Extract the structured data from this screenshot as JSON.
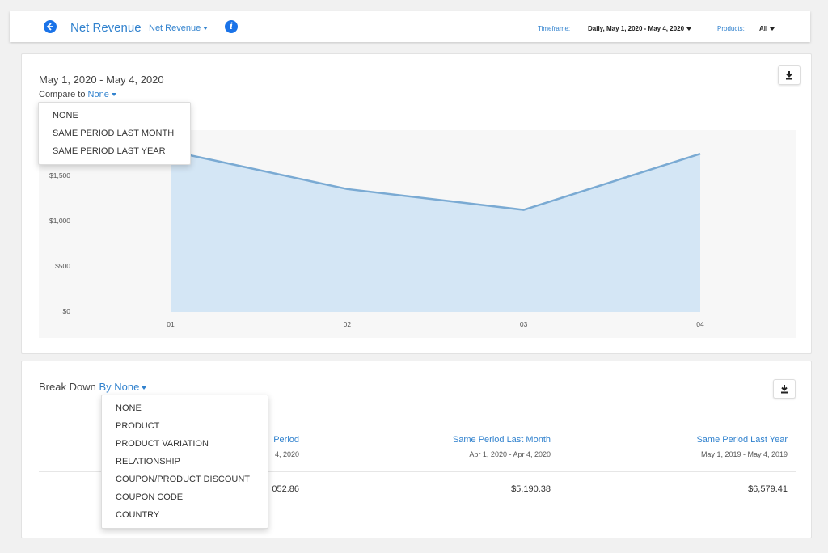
{
  "header": {
    "title": "Net Revenue",
    "metric_select": "Net Revenue",
    "info_icon": "info-icon",
    "timeframe_label": "Timeframe:",
    "timeframe_value": "Daily, May 1, 2020 - May 4, 2020",
    "products_label": "Products:",
    "products_value": "All"
  },
  "chart_card": {
    "range_title": "May 1, 2020 - May 4, 2020",
    "compare_label": "Compare to",
    "compare_value": "None",
    "compare_options": [
      "NONE",
      "SAME PERIOD LAST MONTH",
      "SAME PERIOD LAST YEAR"
    ],
    "download_icon": "download-icon"
  },
  "chart_data": {
    "type": "area",
    "categories": [
      "01",
      "02",
      "03",
      "04"
    ],
    "values": [
      1780,
      1360,
      1130,
      1750
    ],
    "ylim": [
      0,
      1850
    ],
    "yticks": [
      "$0",
      "$500",
      "$1,000",
      "$1,500"
    ],
    "ytick_values": [
      0,
      500,
      1000,
      1500
    ],
    "grid": false,
    "fill_color": "#d4e6f5",
    "line_color": "#7aaad3"
  },
  "breakdown_card": {
    "label": "Break Down",
    "select_value": "By None",
    "options": [
      "NONE",
      "PRODUCT",
      "PRODUCT VARIATION",
      "RELATIONSHIP",
      "COUPON/PRODUCT DISCOUNT",
      "COUPON CODE",
      "COUNTRY"
    ],
    "download_icon": "download-icon",
    "columns": [
      {
        "header": "Period",
        "sub": "4, 2020",
        "value": "052.86"
      },
      {
        "header": "Same Period Last Month",
        "sub": "Apr 1, 2020 - Apr 4, 2020",
        "value": "$5,190.38"
      },
      {
        "header": "Same Period Last Year",
        "sub": "May 1, 2019 - May 4, 2019",
        "value": "$6,579.41"
      }
    ]
  }
}
